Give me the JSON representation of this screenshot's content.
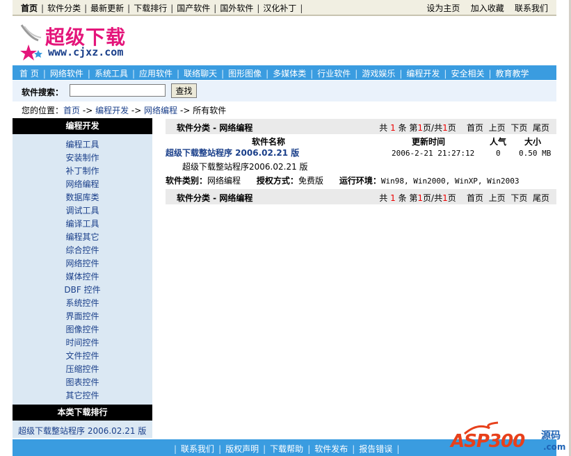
{
  "topbar": {
    "left_links": [
      "首页",
      "软件分类",
      "最新更新",
      "下载排行",
      "国产软件",
      "国外软件",
      "汉化补丁"
    ],
    "right_links": [
      "设为主页",
      "加入收藏",
      "联系我们"
    ]
  },
  "logo": {
    "title": "超级下载",
    "url": "www.cjxz.com"
  },
  "nav": [
    "首 页",
    "网络软件",
    "系统工具",
    "应用软件",
    "联络聊天",
    "图形图像",
    "多媒体类",
    "行业软件",
    "游戏娱乐",
    "编程开发",
    "安全相关",
    "教育教学"
  ],
  "search": {
    "label": "软件搜索：",
    "value": "",
    "button": "查找"
  },
  "breadcrumb": {
    "prefix": "您的位置：",
    "home": "首页",
    "arrow": "->",
    "cat": "编程开发",
    "sub": "网络编程",
    "last": "所有软件"
  },
  "sidebar": {
    "title": "编程开发",
    "items": [
      "编程工具",
      "安装制作",
      "补丁制作",
      "网络编程",
      "数据库类",
      "调试工具",
      "编译工具",
      "编程其它",
      "综合控件",
      "网络控件",
      "媒体控件",
      "DBF 控件",
      "系统控件",
      "界面控件",
      "图像控件",
      "时间控件",
      "文件控件",
      "压缩控件",
      "图表控件",
      "其它控件"
    ],
    "rank_title": "本类下载排行",
    "rank_items": [
      "超级下载整站程序 2006.02.21 版"
    ]
  },
  "listing": {
    "title": "软件分类 - 网络编程",
    "pager": {
      "total_prefix": "共",
      "total": "1",
      "total_suffix": "条 第",
      "page": "1",
      "page_mid": "页/共",
      "pages": "1",
      "page_suffix": "页",
      "first": "首页",
      "prev": "上页",
      "next": "下页",
      "last": "尾页"
    },
    "columns": {
      "name": "软件名称",
      "time": "更新时间",
      "hits": "人气",
      "size": "大小"
    },
    "rows": [
      {
        "name": "超级下载整站程序 2006.02.21 版",
        "time": "2006-2-21 21:27:12",
        "hits": "0",
        "size": "0.50 MB",
        "desc": "超级下载整站程序2006.02.21 版",
        "type_label": "软件类别：",
        "type": "网络编程",
        "license_label": "授权方式：",
        "license": "免费版",
        "env_label": "运行环境：",
        "env": "Win98, Win2000, WinXP, Win2003"
      }
    ]
  },
  "footer": [
    "联系我们",
    "版权声明",
    "下载帮助",
    "软件发布",
    "报告错误"
  ],
  "watermark": {
    "brand": "ASP300",
    "tag": "源码",
    "domain": ".com"
  },
  "colors": {
    "nav_blue": "#3a9ce0",
    "sidebar_bg": "#dbe8f3",
    "link": "#1a3f8a",
    "accent_red": "#e00000"
  }
}
